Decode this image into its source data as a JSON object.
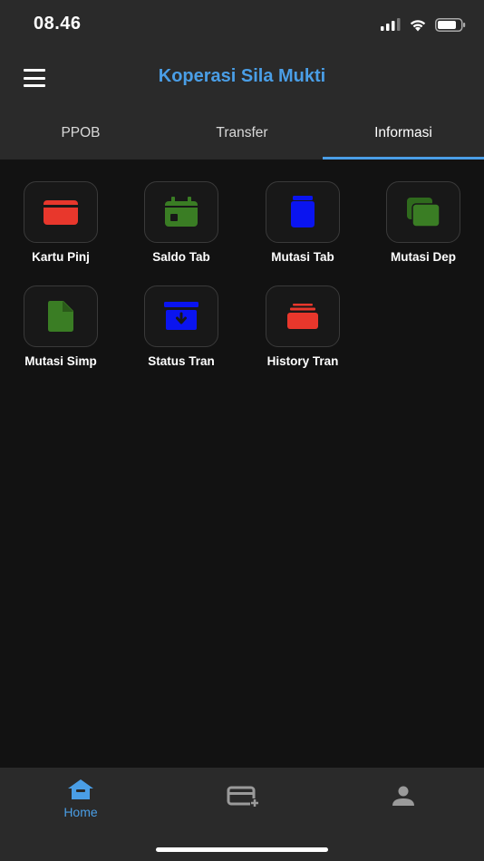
{
  "status_bar": {
    "time": "08.46"
  },
  "header": {
    "title": "Koperasi Sila Mukti",
    "menu_icon": "hamburger-icon"
  },
  "tabs": [
    {
      "label": "PPOB",
      "active": false
    },
    {
      "label": "Transfer",
      "active": false
    },
    {
      "label": "Informasi",
      "active": true
    }
  ],
  "menu_items": [
    {
      "label": "Kartu Pinj",
      "icon": "card-icon",
      "color": "#e8372c"
    },
    {
      "label": "Saldo Tab",
      "icon": "calendar-icon",
      "color": "#3a7d24"
    },
    {
      "label": "Mutasi Tab",
      "icon": "jar-icon",
      "color": "#0a14f0"
    },
    {
      "label": "Mutasi Dep",
      "icon": "copy-icon",
      "color": "#3a7d24"
    },
    {
      "label": "Mutasi Simp",
      "icon": "file-icon",
      "color": "#3a7d24"
    },
    {
      "label": "Status Tran",
      "icon": "archive-icon",
      "color": "#0a14f0"
    },
    {
      "label": "History Tran",
      "icon": "stack-icon",
      "color": "#e8372c"
    }
  ],
  "bottom_nav": {
    "home_label": "Home",
    "accent": "#4a9ee6",
    "icons": [
      "home-icon",
      "add-card-icon",
      "person-icon"
    ]
  }
}
